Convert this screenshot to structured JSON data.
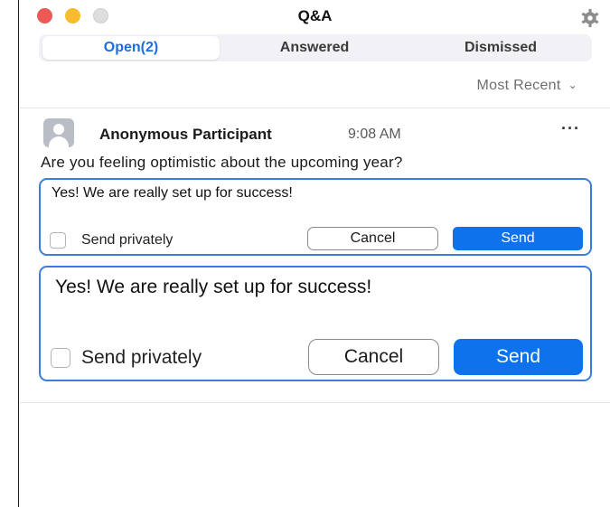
{
  "window": {
    "title": "Q&A"
  },
  "tabs": [
    {
      "label": "Open(2)",
      "active": true
    },
    {
      "label": "Answered",
      "active": false
    },
    {
      "label": "Dismissed",
      "active": false
    }
  ],
  "sort": {
    "label": "Most Recent"
  },
  "question": {
    "author": "Anonymous Participant",
    "time": "9:08 AM",
    "more_label": "···",
    "text": "Are you feeling optimistic about the upcoming year?"
  },
  "replies": [
    {
      "text": "Yes! We are really set up for success!",
      "send_privately_label": "Send privately",
      "send_privately_checked": false,
      "cancel_label": "Cancel",
      "send_label": "Send"
    },
    {
      "text": "Yes! We are really set up for success!",
      "send_privately_label": "Send privately",
      "send_privately_checked": false,
      "cancel_label": "Cancel",
      "send_label": "Send"
    }
  ],
  "colors": {
    "accent": "#0e72ed",
    "active_tab_text": "#1c6fe0",
    "reply_border": "#3b7ddd",
    "close": "#ed5a55",
    "minimize": "#f8bd2f",
    "maximize_disabled": "#dedede"
  },
  "icons": {
    "settings": "gear-icon",
    "avatar": "user-avatar-icon",
    "sort_chevron": "chevron-down-icon",
    "more": "more-options-icon"
  }
}
